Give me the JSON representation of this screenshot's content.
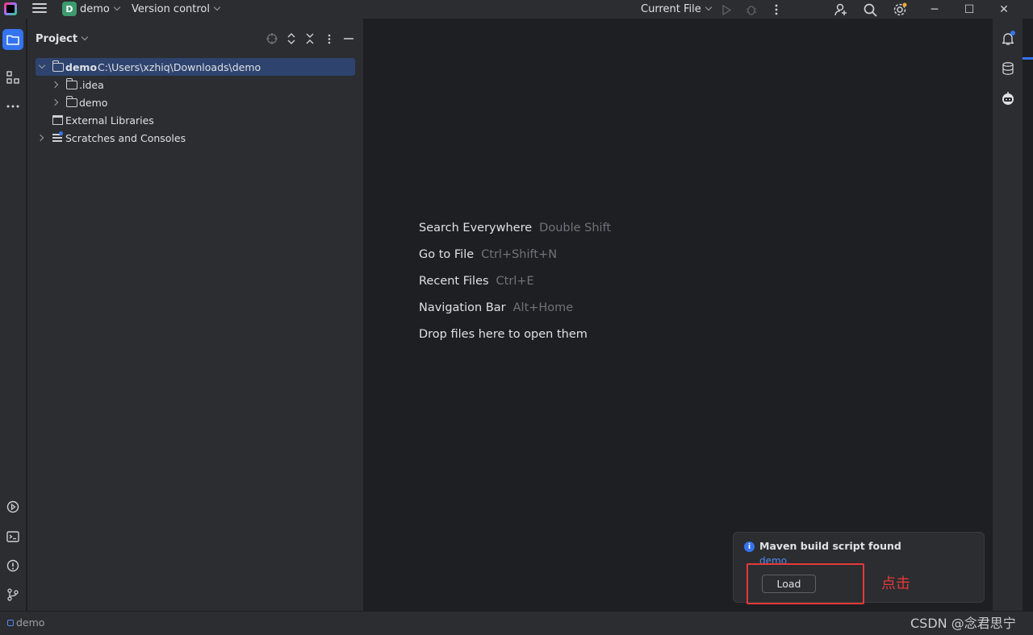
{
  "titlebar": {
    "project_badge": "D",
    "project_name": "demo",
    "vcs_label": "Version control",
    "run_config": "Current File",
    "icons": [
      "hamburger-menu-icon",
      "run-icon",
      "debug-icon",
      "more-vertical-icon",
      "add-user-icon",
      "search-icon",
      "settings-icon"
    ]
  },
  "window_controls": {
    "minimize": "─",
    "maximize": "☐",
    "close": "✕"
  },
  "left_strip": {
    "icons": [
      "project-folder-icon",
      "structure-icon",
      "more-horizontal-icon",
      "services-icon",
      "terminal-icon",
      "problems-icon",
      "git-icon"
    ]
  },
  "project_panel": {
    "title": "Project",
    "tree": [
      {
        "label": "demo",
        "path": "C:\\Users\\xzhiq\\Downloads\\demo",
        "expanded": true,
        "selected": true
      },
      {
        "label": ".idea",
        "expanded": false
      },
      {
        "label": "demo",
        "expanded": false
      },
      {
        "label": "External Libraries"
      },
      {
        "label": "Scratches and Consoles",
        "expanded": false
      }
    ]
  },
  "editor": {
    "hints": [
      {
        "action": "Search Everywhere",
        "shortcut": "Double Shift"
      },
      {
        "action": "Go to File",
        "shortcut": "Ctrl+Shift+N"
      },
      {
        "action": "Recent Files",
        "shortcut": "Ctrl+E"
      },
      {
        "action": "Navigation Bar",
        "shortcut": "Alt+Home"
      },
      {
        "action": "Drop files here to open them",
        "shortcut": ""
      }
    ]
  },
  "right_strip": {
    "icons": [
      "notifications-icon",
      "database-icon",
      "ai-assistant-icon"
    ]
  },
  "notification": {
    "title": "Maven build script found",
    "link": "demo",
    "button_label": "Load"
  },
  "annotation": {
    "text": "点击",
    "color": "#e5393a"
  },
  "statusbar": {
    "project": "demo"
  },
  "watermark": "CSDN @念君思宁",
  "colors": {
    "accent": "#3574f0",
    "panel_bg": "#2b2d30",
    "editor_bg": "#1e1f22",
    "selection": "#2e436e",
    "annotation_red": "#e5393a"
  }
}
